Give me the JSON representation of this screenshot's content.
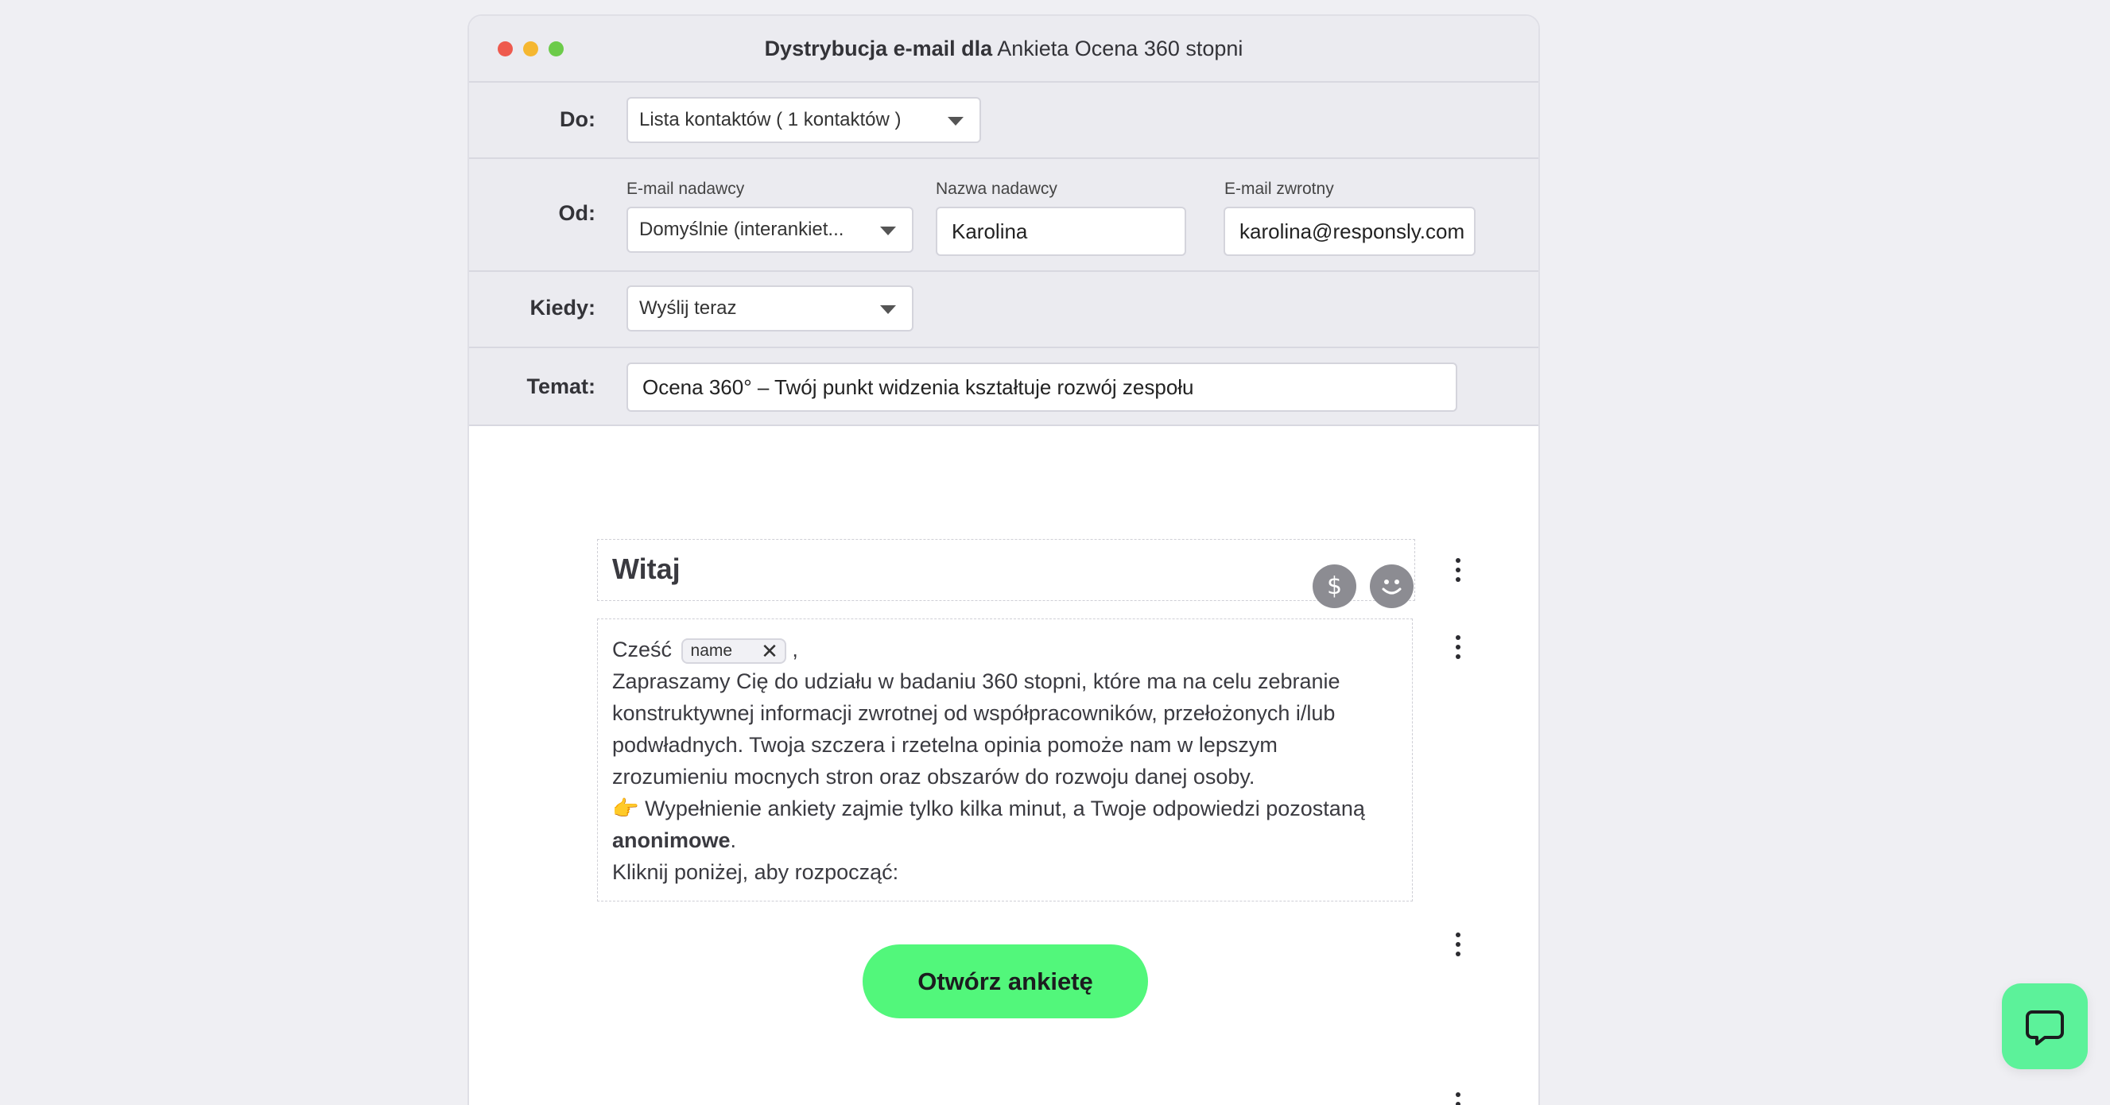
{
  "window": {
    "title_bold": "Dystrybucja e-mail dla",
    "title_rest": "Ankieta Ocena 360 stopni"
  },
  "to": {
    "label": "Do:",
    "value": "Lista kontaktów ( 1 kontaktów )"
  },
  "from": {
    "label": "Od:",
    "sender_email_label": "E-mail nadawcy",
    "sender_email_value": "Domyślnie (interankiet...",
    "sender_name_label": "Nazwa nadawcy",
    "sender_name_value": "Karolina",
    "reply_email_label": "E-mail zwrotny",
    "reply_email_value": "karolina@responsly.com"
  },
  "when": {
    "label": "Kiedy:",
    "value": "Wyślij teraz"
  },
  "subject": {
    "label": "Temat:",
    "value": "Ocena 360° – Twój punkt widzenia kształtuje rozwój zespołu"
  },
  "email": {
    "heading": "Witaj",
    "greeting": "Cześć",
    "tag": "name",
    "greeting_end": " ,",
    "para1": "Zapraszamy Cię do udziału w badaniu 360 stopni, które ma na celu zebranie konstruktywnej informacji zwrotnej od współpracowników, przełożonych i/lub podwładnych. Twoja szczera i rzetelna opinia pomoże nam w lepszym zrozumieniu mocnych stron oraz obszarów do rozwoju danej osoby.",
    "para2_emoji": "👉",
    "para2_text": " Wypełnienie ankiety zajmie tylko kilka minut, a Twoje odpowiedzi pozostaną ",
    "para2_bold": "anonimowe",
    "para2_end": ".",
    "para3": "Kliknij poniżej, aby rozpocząć:",
    "cta": "Otwórz ankietę"
  },
  "icons": {
    "dollar": "dollar-icon",
    "emoji": "smiley-icon",
    "more": "more-vertical-icon",
    "chat": "chat-bubble-icon"
  },
  "colors": {
    "accent": "#52f77b",
    "help": "#5cf29a"
  }
}
